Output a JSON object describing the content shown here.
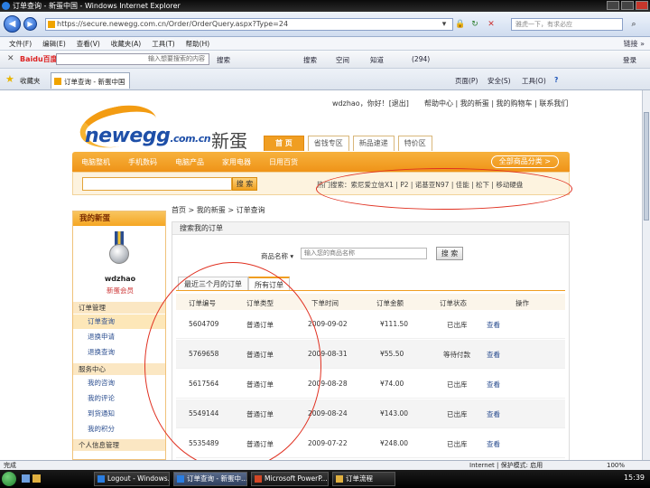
{
  "window": {
    "title": "订单查询 - 新蛋中国 - Windows Internet Explorer",
    "url": "https://secure.newegg.com.cn/Order/OrderQuery.aspx?Type=24",
    "search_placeholder": "雅虎一下，有求必应"
  },
  "menu": [
    "文件(F)",
    "编辑(E)",
    "查看(V)",
    "收藏夹(A)",
    "工具(T)",
    "帮助(H)"
  ],
  "menu_right": "链接 »",
  "toolbar": {
    "baidu": "Baidu百度",
    "search_hint": "输入想要搜索的内容",
    "items": [
      "搜索",
      "搜索",
      "空间",
      "知道",
      "(294)"
    ],
    "right": [
      "登录"
    ]
  },
  "favorites": {
    "label": "收藏夹",
    "tab": "订单查询 - 新蛋中国",
    "commands": [
      "页面(P)",
      "安全(S)",
      "工具(O)"
    ]
  },
  "site": {
    "login_text": "wdzhao，你好！",
    "logout": "[退出]",
    "top_links": "帮助中心 | 我的新蛋 | 我的购物车 | 联系我们",
    "logo": "newegg",
    "logo_tld": ".com.cn",
    "logo_cn": "新蛋",
    "nav_tabs": [
      "首 页",
      "省钱专区",
      "新品速递",
      "特价区"
    ],
    "categories": [
      "电脑整机",
      "手机数码",
      "电脑产品",
      "家用电器",
      "日用百货"
    ],
    "all_categories": "全部商品分类 >",
    "search_button": "搜 索",
    "hot_words": "热门搜索：索尼爱立信X1 | P2 | 诺基亚N97 | 佳能 | 松下 | 移动硬盘"
  },
  "breadcrumb": "首页 > 我的新蛋 > 订单查询",
  "sidebar": {
    "title": "我的新蛋",
    "username": "wdzhao",
    "level": "新蛋会员",
    "sections": [
      {
        "title": "订单管理",
        "items": [
          "订单查询",
          "退换申请",
          "退换查询"
        ]
      },
      {
        "title": "服务中心",
        "items": [
          "我的咨询",
          "我的评论",
          "到货通知",
          "我的积分"
        ]
      },
      {
        "title": "个人信息管理",
        "items": []
      }
    ]
  },
  "orders": {
    "title": "搜索我的订单",
    "filter_label": "商品名称",
    "filter_placeholder": "输入您的商品名称",
    "filter_button": "搜 索",
    "tabs": [
      "最近三个月的订单",
      "所有订单"
    ],
    "active_tab": 1,
    "headers": [
      "订单编号",
      "订单类型",
      "下单时间",
      "订单金额",
      "订单状态",
      "操作"
    ],
    "rows": [
      {
        "id": "5604709",
        "type": "普通订单",
        "date": "2009-09-02",
        "amount": "¥111.50",
        "status": "已出库",
        "action": "查看"
      },
      {
        "id": "5769658",
        "type": "普通订单",
        "date": "2009-08-31",
        "amount": "¥55.50",
        "status": "等待付款",
        "action": "查看"
      },
      {
        "id": "5617564",
        "type": "普通订单",
        "date": "2009-08-28",
        "amount": "¥74.00",
        "status": "已出库",
        "action": "查看"
      },
      {
        "id": "5549144",
        "type": "普通订单",
        "date": "2009-08-24",
        "amount": "¥143.00",
        "status": "已出库",
        "action": "查看"
      },
      {
        "id": "5535489",
        "type": "普通订单",
        "date": "2009-07-22",
        "amount": "¥248.00",
        "status": "已出库",
        "action": "查看"
      }
    ]
  },
  "statusbar": {
    "left": "完成",
    "zone": "Internet | 保护模式: 启用",
    "zoom": "100%"
  },
  "taskbar": {
    "tasks": [
      "Logout - Windows...",
      "订单查询 - 新蛋中...",
      "Microsoft PowerP...",
      "订单流程"
    ],
    "time": "15:39"
  }
}
